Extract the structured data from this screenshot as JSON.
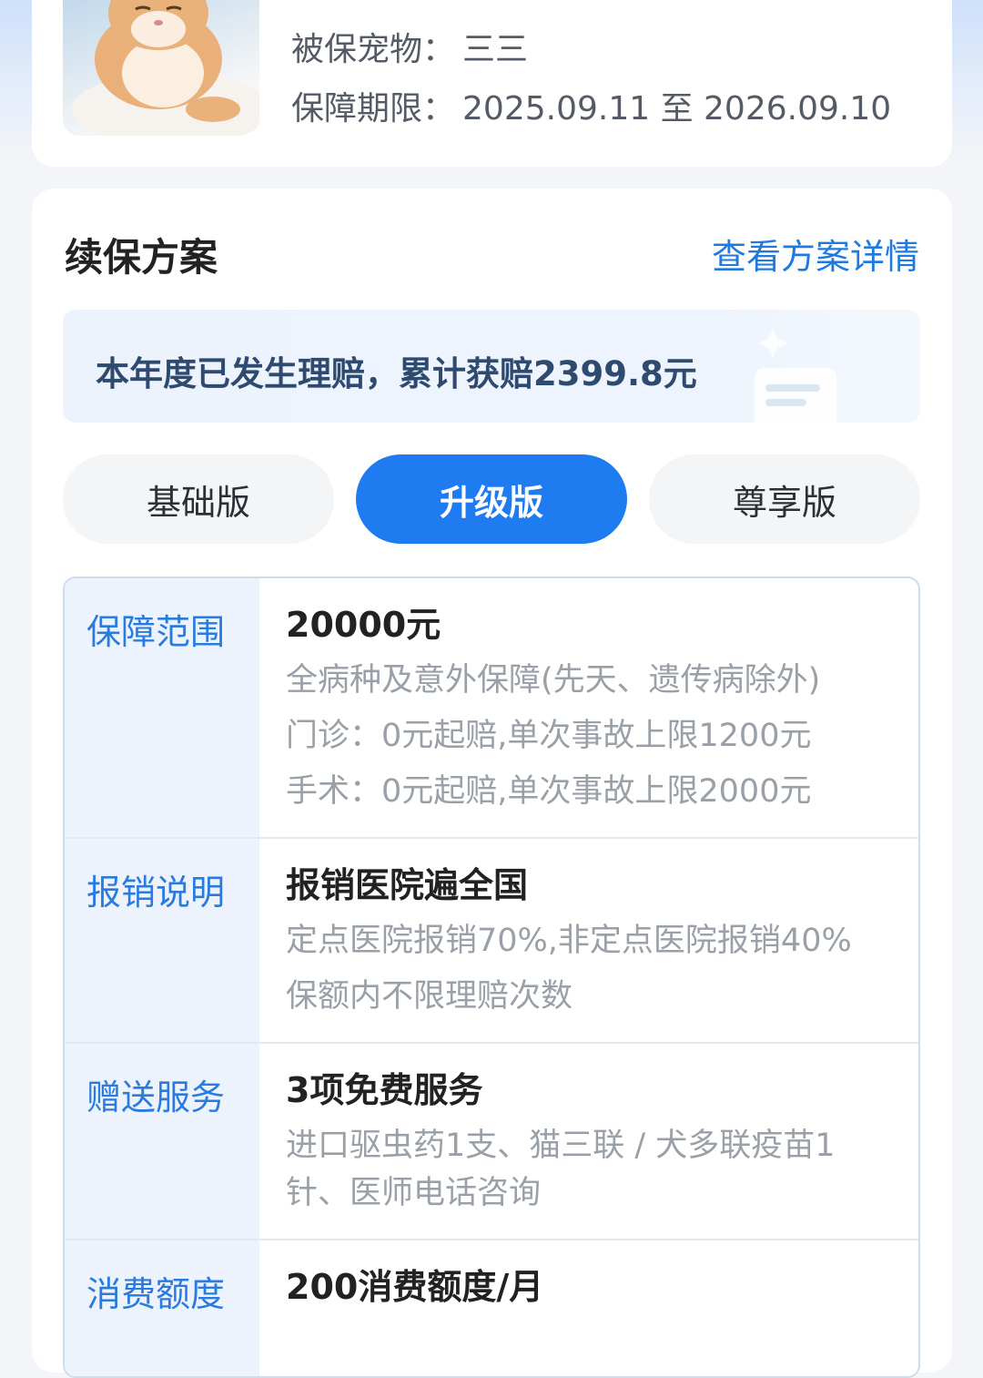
{
  "policy": {
    "pet_label": "被保宠物：",
    "pet_name": "三三",
    "period_label": "保障期限：",
    "period_value": "2025.09.11 至 2026.09.10"
  },
  "renewal": {
    "title": "续保方案",
    "detail_link": "查看方案详情",
    "claim_notice": "本年度已发生理赔，累计获赔2399.8元",
    "tabs": [
      {
        "label": "基础版",
        "active": false
      },
      {
        "label": "升级版",
        "active": true
      },
      {
        "label": "尊享版",
        "active": false
      }
    ]
  },
  "plan": {
    "rows": [
      {
        "label": "保障范围",
        "heading": "20000元",
        "lines": [
          "全病种及意外保障(先天、遗传病除外)",
          "门诊：0元起赔,单次事故上限1200元",
          "手术：0元起赔,单次事故上限2000元"
        ]
      },
      {
        "label": "报销说明",
        "heading": "报销医院遍全国",
        "lines": [
          "定点医院报销70%,非定点医院报销40%",
          "保额内不限理赔次数"
        ]
      },
      {
        "label": "赠送服务",
        "heading": "3项免费服务",
        "lines": [
          "进口驱虫药1支、猫三联 / 犬多联疫苗1",
          "针、医师电话咨询"
        ]
      },
      {
        "label": "消费额度",
        "heading": "200消费额度/月",
        "lines": []
      }
    ]
  },
  "colors": {
    "accent": "#1f7cf0",
    "link": "#1f7ae0",
    "label_bg": "#edf3fc"
  }
}
